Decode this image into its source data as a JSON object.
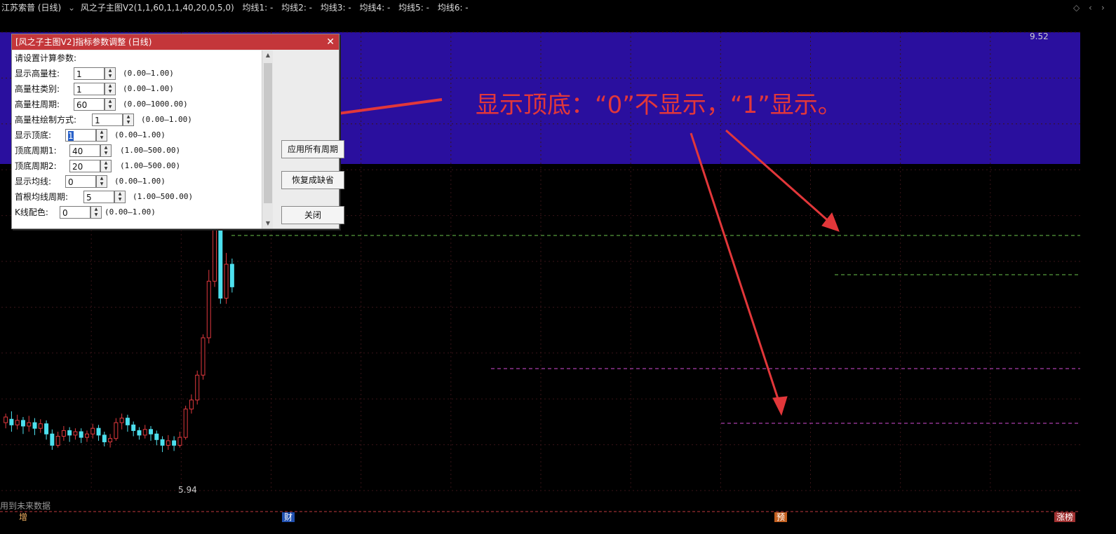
{
  "title_bar": {
    "stock": "江苏索普 (日线)",
    "indicator": "风之子主图V2(1,1,60,1,1,40,20,0,5,0)",
    "ma_lines": [
      "均线1: -",
      "均线2: -",
      "均线3: -",
      "均线4: -",
      "均线5: -",
      "均线6: -"
    ]
  },
  "dialog": {
    "title": "[风之子主图V2]指标参数调整 (日线)",
    "heading": "请设置计算参数:",
    "params": [
      {
        "label": "显示高量柱:",
        "value": "1",
        "range": "(0.00—1.00)"
      },
      {
        "label": "高量柱类别:",
        "value": "1",
        "range": "(0.00—1.00)"
      },
      {
        "label": "高量柱周期:",
        "value": "60",
        "range": "(0.00—1000.00)"
      },
      {
        "label": "高量柱绘制方式:",
        "value": "1",
        "range": "(0.00—1.00)"
      },
      {
        "label": "显示顶底:",
        "value": "1",
        "range": "(0.00—1.00)"
      },
      {
        "label": "顶底周期1:",
        "value": "40",
        "range": "(1.00—500.00)"
      },
      {
        "label": "顶底周期2:",
        "value": "20",
        "range": "(1.00—500.00)"
      },
      {
        "label": "显示均线:",
        "value": "0",
        "range": "(0.00—1.00)"
      },
      {
        "label": "首根均线周期:",
        "value": "5",
        "range": "(1.00—500.00)"
      },
      {
        "label": "K线配色:",
        "value": "0",
        "range": "(0.00—1.00)"
      }
    ],
    "buttons": {
      "apply_all": "应用所有周期",
      "restore": "恢复成缺省",
      "close": "关闭"
    }
  },
  "annotation": "显示顶底：“0”不显示，“1”显示。",
  "chart_labels": {
    "high": "9.52",
    "low": "5.94",
    "future_warning": "用到未来数据"
  },
  "bottom_markers": [
    "增",
    "财",
    "预",
    "涨榜"
  ],
  "colors": {
    "up": "#e0393e",
    "down": "#4de0ee",
    "highlight_band": "#2a0f9e",
    "dash_top": "#6cc34d",
    "dash_bottom": "#d44bd6",
    "annotation": "#e2373a"
  },
  "chart_data": {
    "type": "candlestick",
    "ylim": [
      5.6,
      9.65
    ],
    "high": 9.52,
    "low": 5.94,
    "candles": [
      [
        6.2,
        6.25,
        6.15,
        6.28
      ],
      [
        6.23,
        6.18,
        6.12,
        6.3
      ],
      [
        6.18,
        6.22,
        6.14,
        6.27
      ],
      [
        6.22,
        6.17,
        6.1,
        6.25
      ],
      [
        6.17,
        6.2,
        6.12,
        6.26
      ],
      [
        6.2,
        6.15,
        6.09,
        6.24
      ],
      [
        6.15,
        6.19,
        6.11,
        6.23
      ],
      [
        6.19,
        6.1,
        6.05,
        6.22
      ],
      [
        6.1,
        6.0,
        5.96,
        6.14
      ],
      [
        6.0,
        6.08,
        5.98,
        6.12
      ],
      [
        6.08,
        6.13,
        6.04,
        6.17
      ],
      [
        6.13,
        6.09,
        6.03,
        6.16
      ],
      [
        6.09,
        6.12,
        6.05,
        6.15
      ],
      [
        6.12,
        6.07,
        6.02,
        6.15
      ],
      [
        6.07,
        6.1,
        6.03,
        6.13
      ],
      [
        6.1,
        6.15,
        6.06,
        6.19
      ],
      [
        6.15,
        6.09,
        6.04,
        6.18
      ],
      [
        6.09,
        6.03,
        5.99,
        6.12
      ],
      [
        6.03,
        6.06,
        5.98,
        6.1
      ],
      [
        6.06,
        6.2,
        6.04,
        6.24
      ],
      [
        6.2,
        6.24,
        6.14,
        6.28
      ],
      [
        6.24,
        6.18,
        6.12,
        6.27
      ],
      [
        6.18,
        6.13,
        6.08,
        6.21
      ],
      [
        6.13,
        6.09,
        6.05,
        6.16
      ],
      [
        6.09,
        6.14,
        6.06,
        6.18
      ],
      [
        6.14,
        6.1,
        6.04,
        6.17
      ],
      [
        6.1,
        6.05,
        6.0,
        6.13
      ],
      [
        6.05,
        6.0,
        5.94,
        6.08
      ],
      [
        6.0,
        6.04,
        5.96,
        6.09
      ],
      [
        6.04,
        6.0,
        5.95,
        6.08
      ],
      [
        6.0,
        6.07,
        5.98,
        6.12
      ],
      [
        6.07,
        6.32,
        6.05,
        6.35
      ],
      [
        6.32,
        6.4,
        6.28,
        6.45
      ],
      [
        6.4,
        6.62,
        6.36,
        6.66
      ],
      [
        6.62,
        6.95,
        6.58,
        6.98
      ],
      [
        6.95,
        7.45,
        6.9,
        7.55
      ],
      [
        7.45,
        8.2,
        7.4,
        8.3
      ],
      [
        8.2,
        7.3,
        7.25,
        8.25
      ],
      [
        7.3,
        7.6,
        7.25,
        7.7
      ],
      [
        7.6,
        7.4,
        7.35,
        7.65
      ]
    ]
  }
}
